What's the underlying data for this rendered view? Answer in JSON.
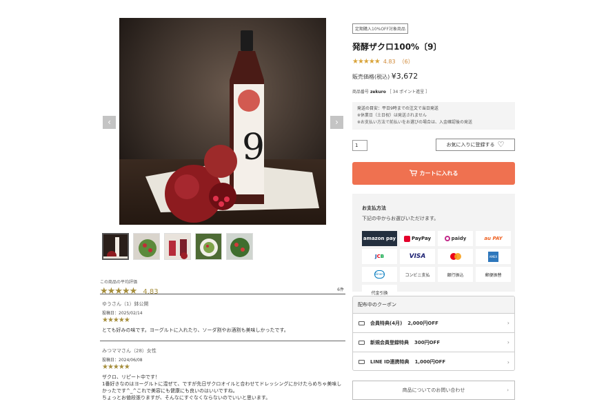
{
  "gallery": {
    "prev_icon": "chevron-left-icon",
    "next_icon": "chevron-right-icon",
    "prev_glyph": "‹",
    "next_glyph": "›",
    "thumbnail_count": 5
  },
  "product": {
    "badge": "定期購入10%OFF対象商品",
    "title": "発酵ザクロ100%〔9〕",
    "stars": "★★★★★",
    "rating": "4.83",
    "rating_count": "（6）",
    "price_label": "販売価格(税込)",
    "price": "¥3,672",
    "sku_label": "商品番号",
    "sku": "zekuro",
    "points": "［ 34 ポイント進呈 ］",
    "shipping_title": "発送の目安：平日9時までの注文で当日発送",
    "shipping_note1": "※休業日（土日祝）は発送されません",
    "shipping_note2": "※お支払い方法で前払いをお選びの場合は、入金確認後の発送",
    "quantity": "1",
    "favorite_label": "お気に入りに登録する",
    "favorite_icon": "heart-icon",
    "cart_label": "カートに入れる",
    "cart_icon": "cart-icon"
  },
  "payment": {
    "title": "お支払方法",
    "subtitle": "下記の中からお選びいただけます。",
    "amazon": "amazon pay",
    "paypay": "PayPay",
    "paidy": "paidy",
    "aupay": "au PAY",
    "jcb_j": "J",
    "jcb_c": "C",
    "jcb_b": "B",
    "visa": "VISA",
    "amex": "AMEX",
    "diners": "Diners",
    "konbini": "コンビニ支払",
    "bank": "銀行振込",
    "postal": "郵便振替",
    "cod": "代金引換"
  },
  "coupons": {
    "title": "配布中のクーポン",
    "items": [
      {
        "name": "会員特典(4月)",
        "value": "2,000円OFF"
      },
      {
        "name": "新規会員登録特典",
        "value": "300円OFF"
      },
      {
        "name": "LINE ID連携特典",
        "value": "1,000円OFF"
      }
    ],
    "chevron": "›"
  },
  "inquiry": {
    "label": "商品についてのお問い合わせ",
    "chevron": "›"
  },
  "reviews": {
    "header": "この商品の平均評価",
    "stars": "★★★★★",
    "average": "4.83",
    "count": "6件",
    "items": [
      {
        "name": "ゆうさん（1）鉢公開",
        "date": "投稿日：2025/02/14",
        "stars": "★★★★★",
        "body": "とても好みの味です。ヨーグルトに入れたり、ソーダ割やお酒割も美味しかったです。"
      },
      {
        "name": "みつママさん（28）女性",
        "date": "投稿日：2024/06/08",
        "stars": "★★★★★",
        "body": "ザクロ、リピート中です！\n1番好きなのはヨーグルトに混ぜて、ですが先日ザクロオイルと合わせてドレッシングにかけたらめちゃ美味しかったです^_^これで美容にも健康にも良いのはいいですね。\nちょっとお値段張りますが、そんなにすぐなくならないのでいいと思います。"
      }
    ]
  }
}
